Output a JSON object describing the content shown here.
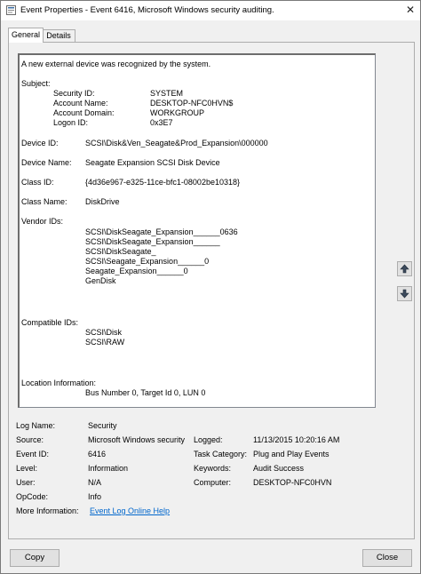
{
  "window": {
    "title": "Event Properties - Event 6416, Microsoft Windows security auditing.",
    "close_glyph": "✕"
  },
  "tabs": [
    {
      "label": "General"
    },
    {
      "label": "Details"
    }
  ],
  "description": {
    "intro": "A new external device was recognized by the system.",
    "subject_label": "Subject:",
    "subject": [
      {
        "label": "Security ID:",
        "value": "SYSTEM"
      },
      {
        "label": "Account Name:",
        "value": "DESKTOP-NFC0HVN$"
      },
      {
        "label": "Account Domain:",
        "value": "WORKGROUP"
      },
      {
        "label": "Logon ID:",
        "value": "0x3E7"
      }
    ],
    "device_id": {
      "label": "Device ID:",
      "value": "SCSI\\Disk&Ven_Seagate&Prod_Expansion\\000000"
    },
    "device_name": {
      "label": "Device Name:",
      "value": "Seagate Expansion SCSI Disk Device"
    },
    "class_id": {
      "label": "Class ID:",
      "value": "{4d36e967-e325-11ce-bfc1-08002be10318}"
    },
    "class_name": {
      "label": "Class Name:",
      "value": "DiskDrive"
    },
    "vendor_ids_label": "Vendor IDs:",
    "vendor_ids": [
      "SCSI\\DiskSeagate_Expansion______0636",
      "SCSI\\DiskSeagate_Expansion______",
      "SCSI\\DiskSeagate_",
      "SCSI\\Seagate_Expansion______0",
      "Seagate_Expansion______0",
      "GenDisk"
    ],
    "compatible_ids_label": "Compatible IDs:",
    "compatible_ids": [
      "SCSI\\Disk",
      "SCSI\\RAW"
    ],
    "location_label": "Location Information:",
    "location_value": "Bus Number 0, Target Id 0, LUN 0"
  },
  "fields": {
    "log_name": {
      "label": "Log Name:",
      "value": "Security"
    },
    "source": {
      "label": "Source:",
      "value": "Microsoft Windows security"
    },
    "logged": {
      "label": "Logged:",
      "value": "11/13/2015 10:20:16 AM"
    },
    "event_id": {
      "label": "Event ID:",
      "value": "6416"
    },
    "task_category": {
      "label": "Task Category:",
      "value": "Plug and Play Events"
    },
    "level": {
      "label": "Level:",
      "value": "Information"
    },
    "keywords": {
      "label": "Keywords:",
      "value": "Audit Success"
    },
    "user": {
      "label": "User:",
      "value": "N/A"
    },
    "computer": {
      "label": "Computer:",
      "value": "DESKTOP-NFC0HVN"
    },
    "opcode": {
      "label": "OpCode:",
      "value": "Info"
    },
    "more_info": {
      "label": "More Information:",
      "link": "Event Log Online Help"
    }
  },
  "buttons": {
    "copy": "Copy",
    "close": "Close"
  },
  "icons": {
    "title": "event-properties-icon",
    "scroll_up": "scroll-up-arrow-icon",
    "scroll_down": "scroll-down-arrow-icon"
  }
}
